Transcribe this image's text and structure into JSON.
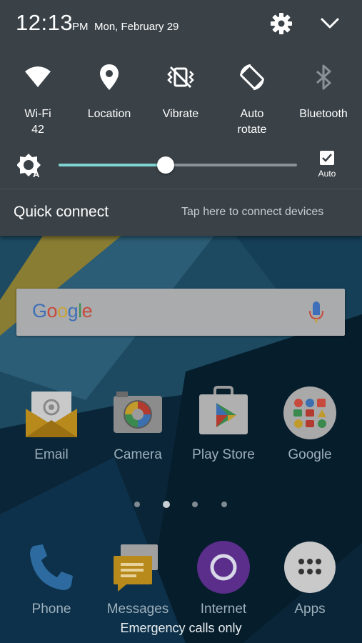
{
  "status": {
    "time": "12:13",
    "ampm": "PM",
    "date": "Mon, February 29"
  },
  "quick_settings": [
    {
      "id": "wifi",
      "icon": "wifi-icon",
      "label": "Wi-Fi",
      "sub": "42"
    },
    {
      "id": "location",
      "icon": "location-icon",
      "label": "Location",
      "sub": ""
    },
    {
      "id": "vibrate",
      "icon": "vibrate-icon",
      "label": "Vibrate",
      "sub": ""
    },
    {
      "id": "auto-rotate",
      "icon": "rotate-icon",
      "label": "Auto",
      "sub": "rotate"
    },
    {
      "id": "bluetooth",
      "icon": "bluetooth-icon",
      "label": "Bluetooth",
      "sub": ""
    }
  ],
  "brightness": {
    "level": 0.45,
    "auto_checked": true,
    "auto_label": "Auto"
  },
  "quick_connect": {
    "title": "Quick connect",
    "hint": "Tap here to connect devices"
  },
  "search": {
    "logo": [
      "G",
      "o",
      "o",
      "g",
      "l",
      "e"
    ]
  },
  "apps": [
    {
      "name": "Email",
      "icon": "email-icon"
    },
    {
      "name": "Camera",
      "icon": "camera-icon"
    },
    {
      "name": "Play Store",
      "icon": "play-store-icon"
    },
    {
      "name": "Google",
      "icon": "google-folder-icon"
    }
  ],
  "page_indicator": {
    "count": 4,
    "active_index": 1
  },
  "dock": [
    {
      "name": "Phone",
      "icon": "phone-icon"
    },
    {
      "name": "Messages",
      "icon": "messages-icon"
    },
    {
      "name": "Internet",
      "icon": "internet-icon"
    },
    {
      "name": "Apps",
      "icon": "apps-grid-icon"
    }
  ],
  "footer": {
    "emergency": "Emergency calls only"
  },
  "colors": {
    "shade": "#3a4248",
    "slider_accent": "#7fd3d0",
    "google_blue": "#4285f4",
    "google_red": "#ea4335",
    "google_yellow": "#fbbc05",
    "google_green": "#34a853"
  }
}
